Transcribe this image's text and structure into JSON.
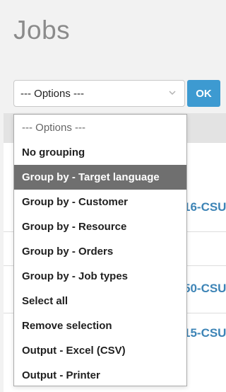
{
  "page": {
    "title": "Jobs"
  },
  "form": {
    "select_value": "--- Options ---",
    "ok_label": "OK"
  },
  "dropdown": {
    "items": [
      {
        "label": "--- Options ---"
      },
      {
        "label": "No grouping"
      },
      {
        "label": "Group by - Target language"
      },
      {
        "label": "Group by - Customer"
      },
      {
        "label": "Group by - Resource"
      },
      {
        "label": "Group by - Orders"
      },
      {
        "label": "Group by - Job types"
      },
      {
        "label": "Select all"
      },
      {
        "label": "Remove selection"
      },
      {
        "label": "Output - Excel (CSV)"
      },
      {
        "label": "Output - Printer"
      }
    ],
    "selected_label": "Group by - Target language"
  },
  "background_table": {
    "visible_codes": [
      "16-CSU",
      "50-CSU",
      "15-CSU"
    ]
  },
  "colors": {
    "accent": "#3d9ad1",
    "link": "#3d84b6",
    "selected_row": "#6f6f6f"
  }
}
